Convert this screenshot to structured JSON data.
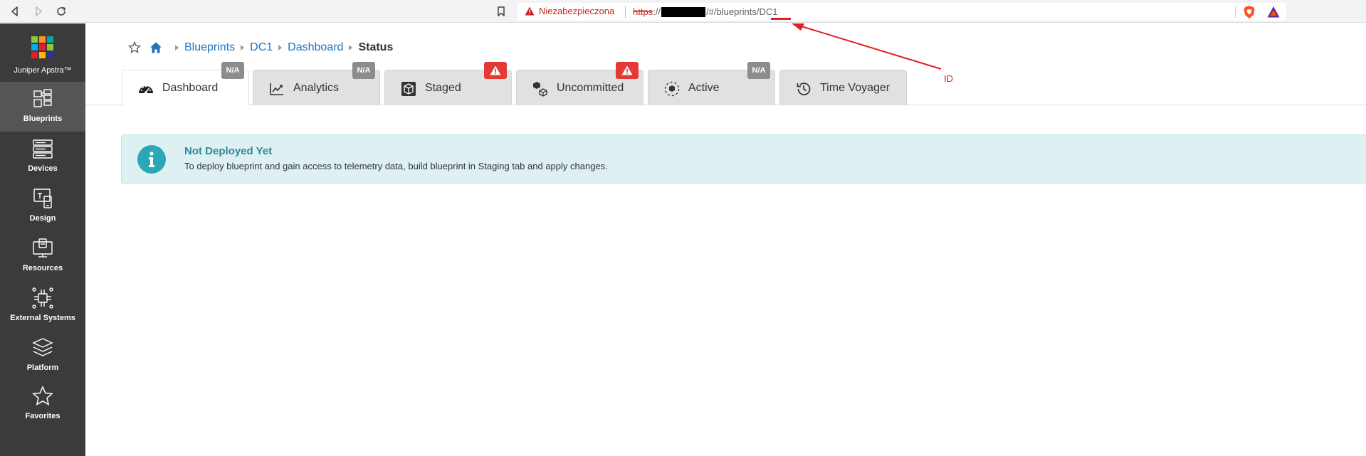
{
  "browser": {
    "security_label": "Niezabezpieczona",
    "url_scheme": "https",
    "url_sep": "://",
    "url_path": "/#/blueprints/",
    "url_id": "DC1"
  },
  "annotation": {
    "label": "ID",
    "color": "#e02020"
  },
  "sidebar": {
    "brand": "Juniper Apstra™",
    "items": [
      {
        "label": "Blueprints",
        "icon": "blueprints-icon",
        "active": true
      },
      {
        "label": "Devices",
        "icon": "devices-icon",
        "active": false
      },
      {
        "label": "Design",
        "icon": "design-icon",
        "active": false
      },
      {
        "label": "Resources",
        "icon": "resources-icon",
        "active": false
      },
      {
        "label": "External Systems",
        "icon": "external-systems-icon",
        "active": false
      },
      {
        "label": "Platform",
        "icon": "platform-icon",
        "active": false
      },
      {
        "label": "Favorites",
        "icon": "favorites-icon",
        "active": false
      }
    ]
  },
  "breadcrumb": {
    "items": [
      "Blueprints",
      "DC1",
      "Dashboard"
    ],
    "current": "Status"
  },
  "tabs": [
    {
      "label": "Dashboard",
      "badge": "N/A",
      "badge_type": "na",
      "active": true
    },
    {
      "label": "Analytics",
      "badge": "N/A",
      "badge_type": "na",
      "active": false
    },
    {
      "label": "Staged",
      "badge": "",
      "badge_type": "warn",
      "active": false
    },
    {
      "label": "Uncommitted",
      "badge": "",
      "badge_type": "warn",
      "active": false
    },
    {
      "label": "Active",
      "badge": "N/A",
      "badge_type": "na",
      "active": false
    },
    {
      "label": "Time Voyager",
      "badge": "",
      "badge_type": "none",
      "active": false
    }
  ],
  "info": {
    "title": "Not Deployed Yet",
    "text": "To deploy blueprint and gain access to telemetry data, build blueprint in Staging tab and apply changes."
  },
  "colors": {
    "sidebar_bg": "#3b3b3b",
    "link": "#1e73be",
    "info_bg": "#dff0f3",
    "info_accent": "#2a8a9a",
    "warn": "#e53935"
  }
}
